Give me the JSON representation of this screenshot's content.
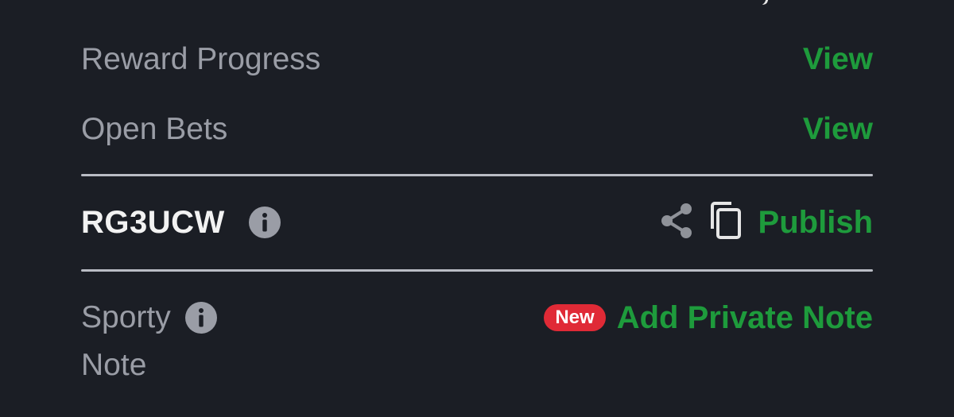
{
  "details": {
    "reward_progress": {
      "label": "Reward Progress",
      "action": "View"
    },
    "open_bets": {
      "label": "Open Bets",
      "action": "View"
    }
  },
  "booking": {
    "code": "RG3UCW",
    "info_icon": "info-icon",
    "share_icon": "share-icon",
    "copy_icon": "copy-icon",
    "publish_label": "Publish"
  },
  "note": {
    "label_line1": "Sporty",
    "label_line2": "Note",
    "info_icon": "info-icon",
    "badge": "New",
    "action": "Add Private Note"
  },
  "colors": {
    "background": "#1b1e25",
    "accent_green": "#1e9b3c",
    "badge_red": "#e02a36",
    "label_gray": "#9a9da6",
    "divider": "#b9bcc4"
  }
}
